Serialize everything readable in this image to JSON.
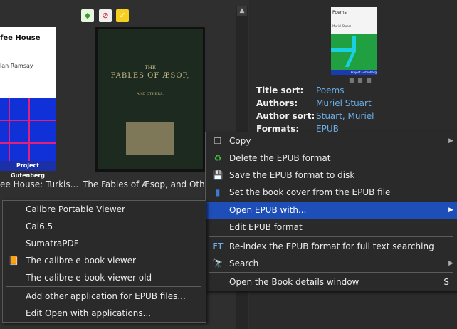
{
  "grid": {
    "book1": {
      "cover_title": "fee House",
      "cover_author": "lan Ramsay",
      "cover_publisher": "Project Gutenberg",
      "caption": "ee House: Turkis..."
    },
    "book2": {
      "cover_title_small": "THE",
      "cover_title": "FABLES OF ÆSOP,",
      "cover_subtitle": "AND OTHERS.",
      "caption": "The Fables of Æsop, and Other"
    }
  },
  "details": {
    "cover": {
      "title": "Poems",
      "author": "Muriel Stuart",
      "publisher": "Project Gutenberg"
    },
    "fields": [
      {
        "label": "Title sort:",
        "value": "Poems"
      },
      {
        "label": "Authors:",
        "value": "Muriel Stuart"
      },
      {
        "label": "Author sort:",
        "value": "Stuart, Muriel"
      },
      {
        "label": "Formats:",
        "value": "EPUB"
      }
    ]
  },
  "main_menu": {
    "items": [
      {
        "label": "Copy",
        "icon": "copy-icon",
        "glyph": "❐",
        "submenu": true
      },
      {
        "label": "Delete the EPUB format",
        "icon": "recycle-icon",
        "glyph": "♻"
      },
      {
        "label": "Save the EPUB format to disk",
        "icon": "floppy-icon",
        "glyph": "💾"
      },
      {
        "label": "Set the book cover from the EPUB file",
        "icon": "book-cover-icon",
        "glyph": "▮"
      },
      {
        "label": "Open EPUB with...",
        "highlighted": true,
        "submenu": true
      },
      {
        "label": "Edit EPUB format"
      },
      {
        "label": "Re-index the EPUB format for full text searching",
        "icon": "ft-icon",
        "glyph": "FT"
      },
      {
        "label": "Search",
        "icon": "binoculars-icon",
        "glyph": "🔭",
        "submenu": true
      },
      {
        "label": "Open the Book details window",
        "shortcut": "S"
      }
    ]
  },
  "sub_menu": {
    "items": [
      {
        "label": "Calibre Portable Viewer"
      },
      {
        "label": "Cal6.5"
      },
      {
        "label": "SumatraPDF"
      },
      {
        "label": "The calibre e-book viewer",
        "icon": "viewer-icon",
        "glyph": "📙"
      },
      {
        "label": "The calibre e-book viewer old"
      },
      {
        "label": "Add other application for EPUB files..."
      },
      {
        "label": "Edit Open with applications..."
      }
    ]
  },
  "colors": {
    "highlight": "#1e4fb8",
    "link": "#6aaeea"
  }
}
